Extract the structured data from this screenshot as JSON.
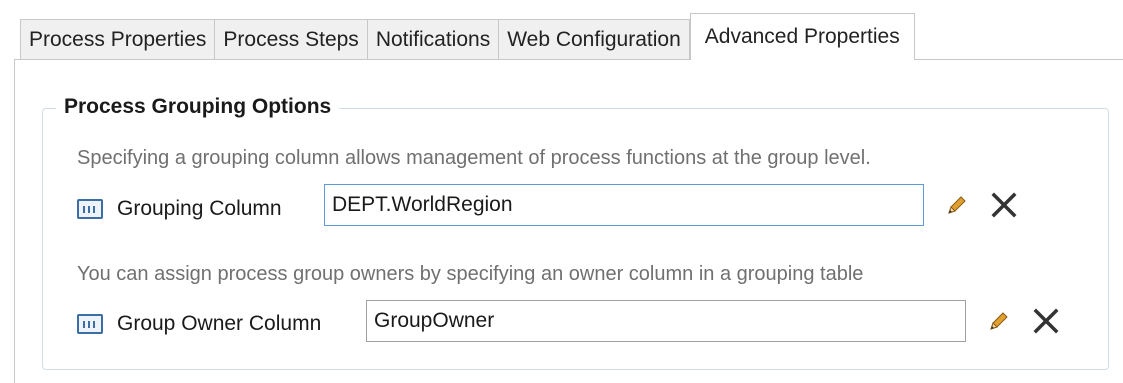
{
  "tabs": [
    {
      "label": "Process Properties",
      "active": false
    },
    {
      "label": "Process Steps",
      "active": false
    },
    {
      "label": "Notifications",
      "active": false
    },
    {
      "label": "Web Configuration",
      "active": false
    },
    {
      "label": "Advanced Properties",
      "active": true
    }
  ],
  "group": {
    "title": "Process Grouping Options",
    "grouping_description": "Specifying a grouping column allows management of process functions at the group level.",
    "grouping_label": "Grouping Column",
    "grouping_value": "DEPT.WorldRegion",
    "owner_description": "You can assign process group owners by specifying an owner column in a grouping table",
    "owner_label": "Group Owner Column",
    "owner_value": "GroupOwner"
  },
  "icons": {
    "column": "table-column-icon",
    "edit": "pencil-icon",
    "clear": "close-icon"
  },
  "colors": {
    "focus_border": "#5b9bd5",
    "pencil": "#e0a030",
    "close": "#333333"
  }
}
